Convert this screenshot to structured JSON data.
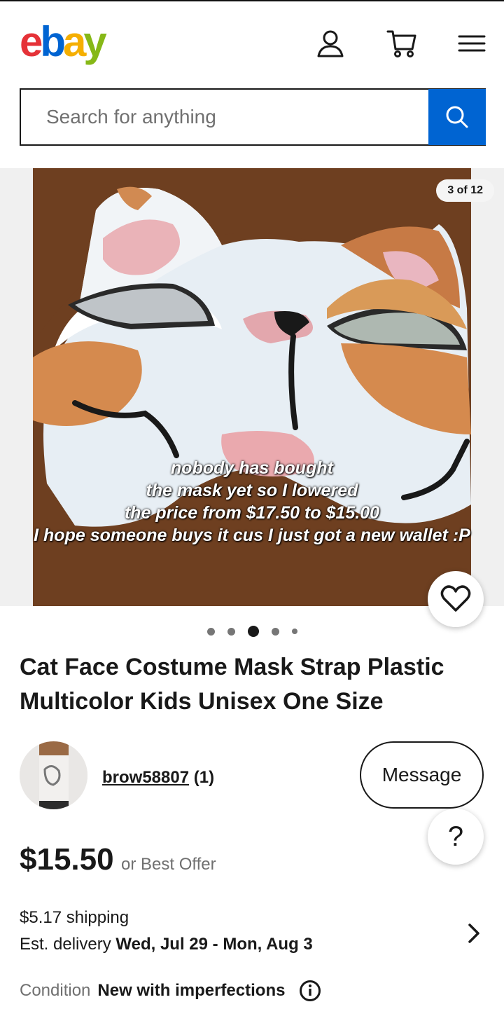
{
  "brand": {
    "letters": [
      "e",
      "b",
      "a",
      "y"
    ]
  },
  "header": {
    "icons": [
      "account-icon",
      "cart-icon",
      "menu-icon"
    ]
  },
  "search": {
    "placeholder": "Search for anything",
    "value": ""
  },
  "gallery": {
    "counter": "3 of 12",
    "caption": [
      "nobody has bought",
      "the mask yet so I lowered",
      "the price from $17.50 to $15.00",
      "I hope someone buys it cus I just got a new wallet :P"
    ],
    "dots": 5,
    "active_dot": 3
  },
  "listing": {
    "title": "Cat Face Costume Mask Strap Plastic Multicolor Kids Unisex One Size",
    "seller_name": "brow58807",
    "seller_feedback": "(1)",
    "message_label": "Message",
    "help_label": "?",
    "price": "$15.50",
    "offer_text": "or Best Offer",
    "shipping": "$5.17 shipping",
    "delivery_label": "Est. delivery",
    "delivery_dates": "Wed, Jul 29 - Mon, Aug 3",
    "condition_label": "Condition",
    "condition_value": "New with imperfections"
  },
  "colors": {
    "accent": "#0064d2",
    "ebay_e": "#e53238",
    "ebay_b": "#0064d2",
    "ebay_a": "#f5af02",
    "ebay_y": "#86b817"
  }
}
